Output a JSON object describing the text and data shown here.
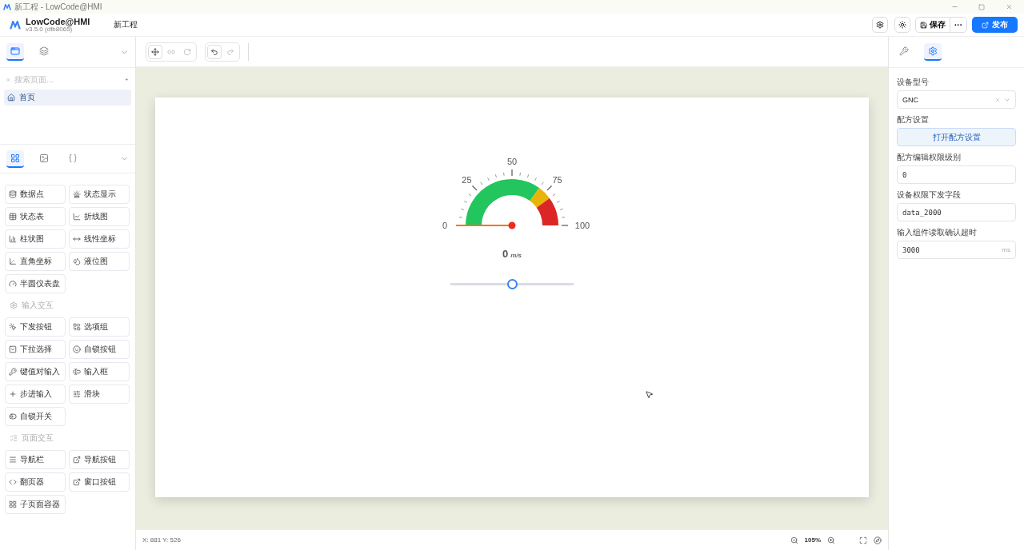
{
  "window": {
    "title": "新工程 - LowCode@HMI"
  },
  "header": {
    "app_name": "LowCode@HMI",
    "version": "v3.5.0 (dfb8065)",
    "project": "新工程",
    "save": "保存",
    "more": "···",
    "publish": "发布"
  },
  "left_panel": {
    "tabs": [
      {
        "selected": true
      },
      {
        "selected": false
      }
    ],
    "search": {
      "placeholder": "搜索页面..."
    },
    "pages": [
      {
        "label": "首页",
        "selected": true
      }
    ],
    "component_tabs": [
      {
        "selected": true
      },
      {
        "selected": false
      },
      {
        "selected": false,
        "label": "{ }"
      }
    ],
    "sections": [
      {
        "items": [
          "数据点",
          "状态显示",
          "状态表",
          "折线图",
          "柱状图",
          "线性坐标",
          "直角坐标",
          "液位图",
          "半圆仪表盘"
        ]
      },
      {
        "title": "输入交互",
        "items": [
          "下发按钮",
          "选项组",
          "下拉选择",
          "自锁按钮",
          "键值对输入",
          "输入框",
          "步进输入",
          "滑块",
          "自锁开关"
        ]
      },
      {
        "title": "页面交互",
        "items": [
          "导航栏",
          "导航按钮",
          "翻页器",
          "窗口按钮",
          "子页面容器"
        ]
      }
    ]
  },
  "toolbar": {
    "tools": [
      {
        "selected": true,
        "disabled": false
      },
      {
        "selected": false,
        "disabled": true
      },
      {
        "selected": false,
        "disabled": true
      }
    ],
    "undo": {
      "disabled": false
    },
    "redo": {
      "disabled": true
    }
  },
  "canvas": {
    "gauge": {
      "ticks": [
        "0",
        "25",
        "50",
        "75",
        "100"
      ],
      "value": "0",
      "unit": "m/s"
    },
    "slider": {
      "level": 0.5
    }
  },
  "status_bar": {
    "coords": "X: 881 Y: 526",
    "zoom": "105%"
  },
  "right_panel": {
    "tabs": [
      {
        "selected": false
      },
      {
        "selected": true
      }
    ],
    "fields": [
      {
        "kind": "select",
        "label": "设备型号",
        "value": "GNC"
      },
      {
        "kind": "button",
        "label": "配方设置",
        "value": "打开配方设置"
      },
      {
        "kind": "input",
        "label": "配方编辑权限级别",
        "value": "0"
      },
      {
        "kind": "input",
        "label": "设备权限下发字段",
        "value": "data_2000"
      },
      {
        "kind": "input",
        "label": "输入组件读取确认超时",
        "value": "3000",
        "suffix": "ms"
      }
    ]
  }
}
